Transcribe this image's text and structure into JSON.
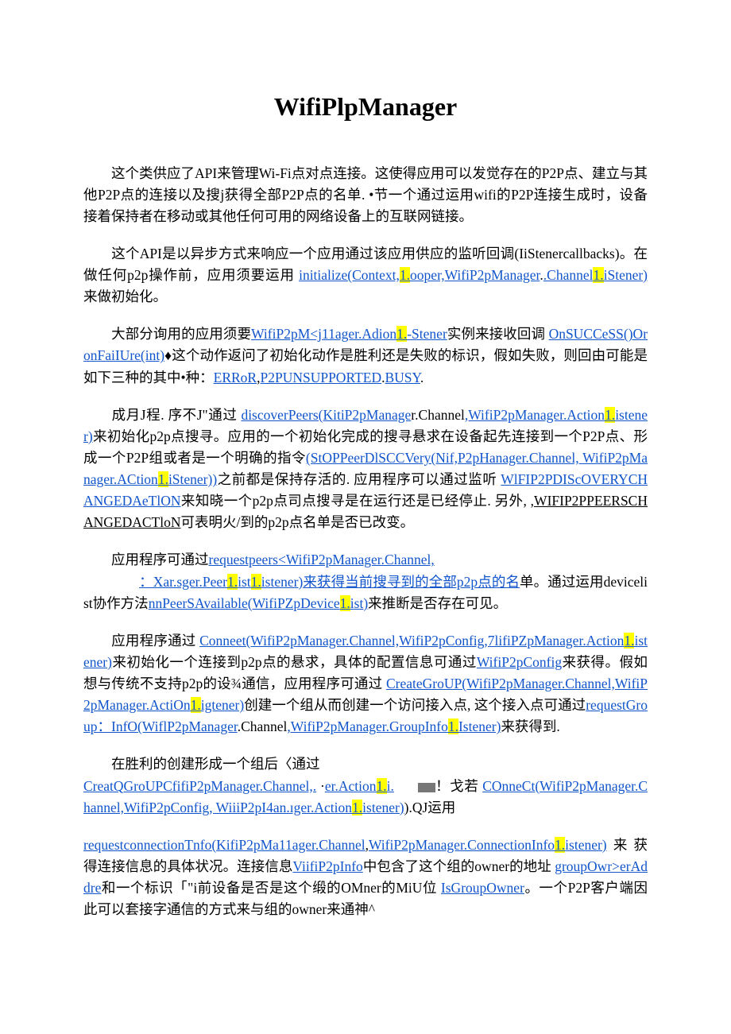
{
  "title": "WifiPlpManager",
  "p1": {
    "a": "这个类供应了API来管理Wi-Fi点对点连接。这使得应用可以发觉存在的P2P点、建立与其他P2P点的连接以及搜j获得全部P2P点的名单. •节一个通过运用wifi的P2P连接生成时，设备接着保持者在移动或其他任何可用的网络设备上的互联网链接。"
  },
  "p2": {
    "a": "这个API是以异步方式来响应一个应用通过该应用供应的监听回调(IiStenercallbacks)。在做任何p2p操作前，应用须要运用",
    "link1a": "initialize(Context,",
    "hl1": "1.",
    "link1b": "ooper,WifiP2pManager",
    "link1c": ".Channel",
    "hl2": "1.",
    "link1d": "iStener)",
    "b": "来做初始化。"
  },
  "p3": {
    "a": "大部分询用的应用须要",
    "link1": "WifiP2pM<j11ager.Adion",
    "hl1": "1.",
    "link1b": "-Stener",
    "b": "实例来接收回调",
    "link2": "OnSUCCeSS()OronFaiIUre(int)",
    "c": "♦这个动作返问了初始化动作是胜利还是失败的标识，假如失败，则回由可能是如下三种的其中•种：",
    "link3": "ERRoR",
    "d": ",",
    "link4": "P2PUNSUPPORTED",
    "e": ".",
    "link5": "BUSY",
    "f": "."
  },
  "p4": {
    "a": "成月J程. 序不J\"通过",
    "link1": "discoverPeers(KitiP2pManage",
    "b": "r.Channel",
    "link2": ",WifiP2pManager.Action",
    "hl1": "1.",
    "link2b": "istener)",
    "c": "来初始化p2p点搜寻。应用的一个初始化完成的搜寻悬求在设备起先连接到一个P2P点、形成一个P2P组或者是一个明确的指令",
    "link3": "(StOPPeerDlSCCVery(Nif,P2pHanager.Channel, WifiP2pManager.ACtion",
    "hl2": "1.",
    "link3b": "iStener))",
    "d": "之前都是保持存活的. 应用程序可以通过监听",
    "link4": "WlFIP2PDIScOVERYCHANGEDAeTlON",
    "e": "来知晓一个p2p点司点搜寻是在运行还是已经停止. 另外, ,",
    "u1": "WIFIP2PPEERSCHANGEDACTloN",
    "f": "可表明火/到的p2p点名单是否已改变。"
  },
  "p5": {
    "a": "应用程序可通过",
    "link1": "requestpeers<WifiP2pManager.Channel,",
    "link2a": "：Xar.sger.Peer",
    "hl1": "1.",
    "link2b": "ist",
    "hl2": "1.",
    "link2c": "istener)",
    "link2tail": "来获得当前搜寻到的全部p2p点的名",
    "b": "单。通过运用devicelist协作方法",
    "link3": "nnPeerSAvailable(WifiPZpDevice",
    "hl3": "1.",
    "link3b": "ist)",
    "c": "来推断是否存在可见。"
  },
  "p6": {
    "a": "应用程序通过",
    "link1": "Conneet(WifiP2pManager.Channel,WifiP2pConfig,7lifiPZpManager.Action",
    "hl1": "1.",
    "link1b": "istener)",
    "b": "来初始化一个连接到p2p点的悬求，具体的配置信息可通过",
    "link2": "WifiP2pConfig",
    "c": "来获得。假如想与传统不支持p2p的设¾通信，应用程序可通过",
    "link3": "CreateGroUP(WifiP2pManager.Channel,WifiP2pManager.ActiOn",
    "hl2": "1.",
    "link3b": "igtener)",
    "d": "创建一个组从而创建一个访问接入点, 这个接入点可通过",
    "link4": "requestGroup：InfO(WiflP2pManager",
    "e": ".Channel",
    "link5": ",WifiP2pManager.GroupInfo",
    "hl3": "1.",
    "link5b": "Istener)",
    "f": "来获得到."
  },
  "p7": {
    "a": "在胜利的创建形成一个组后〈通过",
    "link1": "CreatQGroUPCfifiP2pManager.Channel,.",
    "gap": "   ·",
    "link2": "er.Action",
    "hl1": "1.",
    "link2b": "i.",
    "hl_tail": "！戈若",
    "link3": "COnneCt(WifiP2pManager.Channel,WifiP2pConfig, WiiiP2pI4an.ıger.Action",
    "hl2": "1.",
    "link3b": "istener)",
    "b": ").QJ运用"
  },
  "p8": {
    "link1": "requestconnectionTnfo(KifiP2pMa11ager.Channel",
    "a": ",",
    "link2": "WifiP2pManager.ConnectionInfo",
    "hl1": "1.",
    "link2b": "istener)",
    "b": "来获得连接信息的具体状况。连接信息",
    "link3": "ViifiP2pInfo",
    "c": "中包含了这个组的owner的地址",
    "link4": "groupOwr>erAddre",
    "d": "和一个标识「\"i前设备是否是这个缎的OMner的MiU位",
    "link5": "IsGroupOwner",
    "e": "。一个P2P客户端因此可以套接字通信的方式来与组的owner来通神^"
  }
}
